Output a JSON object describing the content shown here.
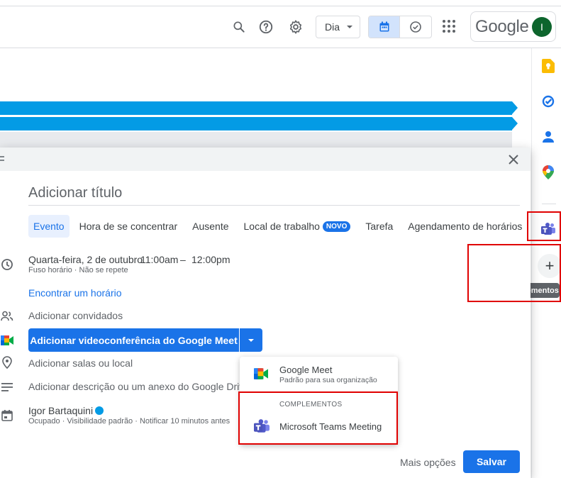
{
  "header": {
    "view_select": "Dia",
    "account_logo": "Google",
    "avatar_initial": "I",
    "icons": [
      "search-icon",
      "help-icon",
      "settings-icon",
      "apps-grid-icon",
      "calendar-icon",
      "tasks-check-icon"
    ]
  },
  "side_panel": {
    "icons": [
      "keep-icon",
      "tasks-icon",
      "contacts-icon",
      "maps-icon",
      "teams-icon",
      "plus-icon"
    ],
    "tooltip": "Instalar complementos"
  },
  "dialog": {
    "title_placeholder": "Adicionar título",
    "tabs": [
      {
        "label": "Evento",
        "active": true
      },
      {
        "label": "Hora de se concentrar"
      },
      {
        "label": "Ausente"
      },
      {
        "label": "Local de trabalho",
        "badge": "NOVO"
      },
      {
        "label": "Tarefa"
      },
      {
        "label": "Agendamento de horários"
      }
    ],
    "date": "Quarta-feira, 2 de outubro",
    "time_start": "11:00am",
    "time_sep": "–",
    "time_end": "12:00pm",
    "time_sub": "Fuso horário · Não se repete",
    "find_time": "Encontrar um horário",
    "add_guests": "Adicionar convidados",
    "meet_button": "Adicionar videoconferência do Google Meet",
    "add_rooms": "Adicionar salas ou local",
    "add_description": "Adicionar descrição ou um anexo do Google Drive",
    "owner_name": "Igor Bartaquini",
    "owner_sub": "Ocupado · Visibilidade padrão · Notificar 10 minutos antes",
    "more_options": "Mais opções",
    "save": "Salvar"
  },
  "conference_menu": {
    "meet_title": "Google Meet",
    "meet_sub": "Padrão para sua organização",
    "section_label": "COMPLEMENTOS",
    "teams_label": "Microsoft Teams Meeting"
  },
  "colors": {
    "accent": "#1a73e8",
    "event_bar": "#039be5",
    "highlight_box": "#e00000"
  }
}
